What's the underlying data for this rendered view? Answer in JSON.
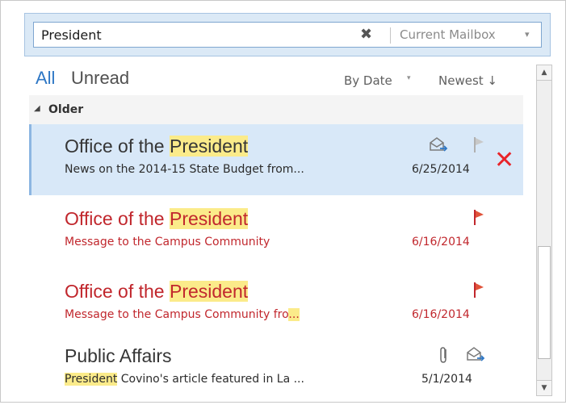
{
  "search": {
    "query": "President",
    "clear_icon": "close-icon",
    "scope": "Current Mailbox",
    "scope_arrow": "▾"
  },
  "filters": {
    "all": "All",
    "unread": "Unread",
    "sort_by": "By Date",
    "sort_by_arrow": "▾",
    "sort_order": "Newest ↓"
  },
  "group": {
    "toggle": "◢",
    "label": "Older"
  },
  "colors": {
    "accent": "#2e77c5",
    "unread": "#c1272d",
    "highlight": "#fbeb8a",
    "selected": "#d8e8f8"
  },
  "messages": [
    {
      "sender_prefix": "Office of the ",
      "sender_highlight": "President",
      "subject_highlight": "",
      "subject_text": "News on the 2014-15 State Budget from...",
      "subject_trail_highlight": "",
      "date": "6/25/2014",
      "icons": [
        "reply-envelope-icon",
        "flag-icon"
      ],
      "selected": true,
      "unread": false,
      "delete_glyph": "✕"
    },
    {
      "sender_prefix": "Office of the ",
      "sender_highlight": "President",
      "subject_highlight": "",
      "subject_text": "Message to the Campus Community",
      "subject_trail_highlight": "",
      "date": "6/16/2014",
      "icons": [
        "flag-icon"
      ],
      "selected": false,
      "unread": true
    },
    {
      "sender_prefix": "Office of the ",
      "sender_highlight": "President",
      "subject_highlight": "",
      "subject_text": "Message to the Campus Community fro",
      "subject_trail_highlight": "...",
      "date": "6/16/2014",
      "icons": [
        "flag-icon"
      ],
      "selected": false,
      "unread": true
    },
    {
      "sender_prefix": "Public Affairs",
      "sender_highlight": "",
      "subject_highlight": "President",
      "subject_text": " Covino's article featured in La ...",
      "subject_trail_highlight": "",
      "date": "5/1/2014",
      "icons": [
        "paperclip-icon",
        "reply-envelope-icon"
      ],
      "selected": false,
      "unread": false
    }
  ],
  "scrollbar": {
    "up": "▲",
    "down": "▼"
  }
}
